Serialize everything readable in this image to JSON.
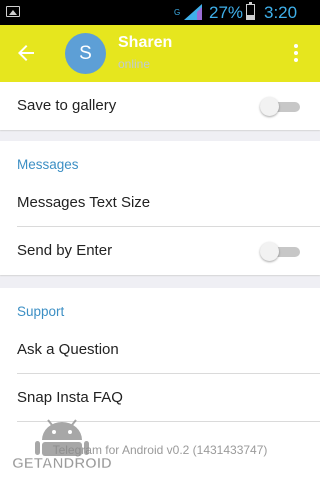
{
  "status_bar": {
    "network_type": "G",
    "battery_percent_text": "27%",
    "battery_level": 0.27,
    "clock": "3:20 PM"
  },
  "header": {
    "avatar_letter": "S",
    "contact_name": "Sharen",
    "contact_status": "online",
    "colors": {
      "bar": "#e6e61e",
      "avatar": "#5d9fd6",
      "accent": "#3c8fc4"
    }
  },
  "settings": {
    "save_to_gallery": {
      "label": "Save to gallery",
      "enabled": false
    },
    "messages_section": {
      "title": "Messages",
      "text_size_label": "Messages Text Size",
      "send_by_enter": {
        "label": "Send by Enter",
        "enabled": false
      }
    },
    "support_section": {
      "title": "Support",
      "ask_question_label": "Ask a Question",
      "faq_label": "Snap Insta FAQ"
    }
  },
  "footer": {
    "version_text": "Telegram for Android v0.2 (1431433747)"
  },
  "watermark": {
    "text": "GETANDROID"
  },
  "icons": [
    "image-icon",
    "signal-icon",
    "battery-icon",
    "back-arrow-icon",
    "more-vert-icon"
  ]
}
